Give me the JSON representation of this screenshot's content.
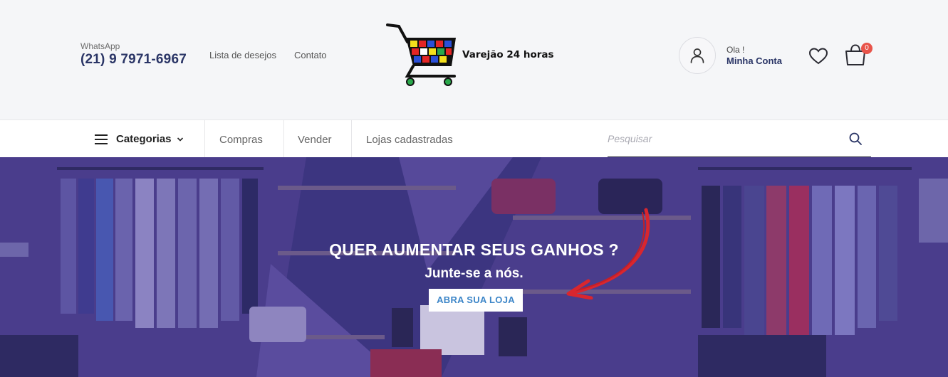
{
  "header": {
    "whatsapp_label": "WhatsApp",
    "whatsapp_number": "(21) 9 7971-6967",
    "links": {
      "wishlist": "Lista de desejos",
      "contact": "Contato"
    },
    "logo_text": "Varejão 24 horas",
    "account": {
      "greeting": "Ola !",
      "label": "Minha Conta"
    },
    "cart_count": "0"
  },
  "nav": {
    "categories_label": "Categorias",
    "items": [
      "Compras",
      "Vender",
      "Lojas cadastradas"
    ],
    "search_placeholder": "Pesquisar"
  },
  "hero": {
    "title": "QUER AUMENTAR SEUS GANHOS ?",
    "subtitle": "Junte-se a nós.",
    "button_label": "ABRA SUA LOJA"
  },
  "icons": {
    "account": "user-icon",
    "wishlist": "heart-icon",
    "cart": "shopping-bag-icon",
    "search": "search-icon",
    "categories": "hamburger-menu-icon",
    "dropdown": "chevron-down-icon"
  },
  "colors": {
    "brand_navy": "#2a3566",
    "cart_badge": "#e8544a",
    "hero_overlay": "#4b3f8e",
    "hero_button_text": "#3d86c8",
    "arrow_red": "#d9262e"
  }
}
